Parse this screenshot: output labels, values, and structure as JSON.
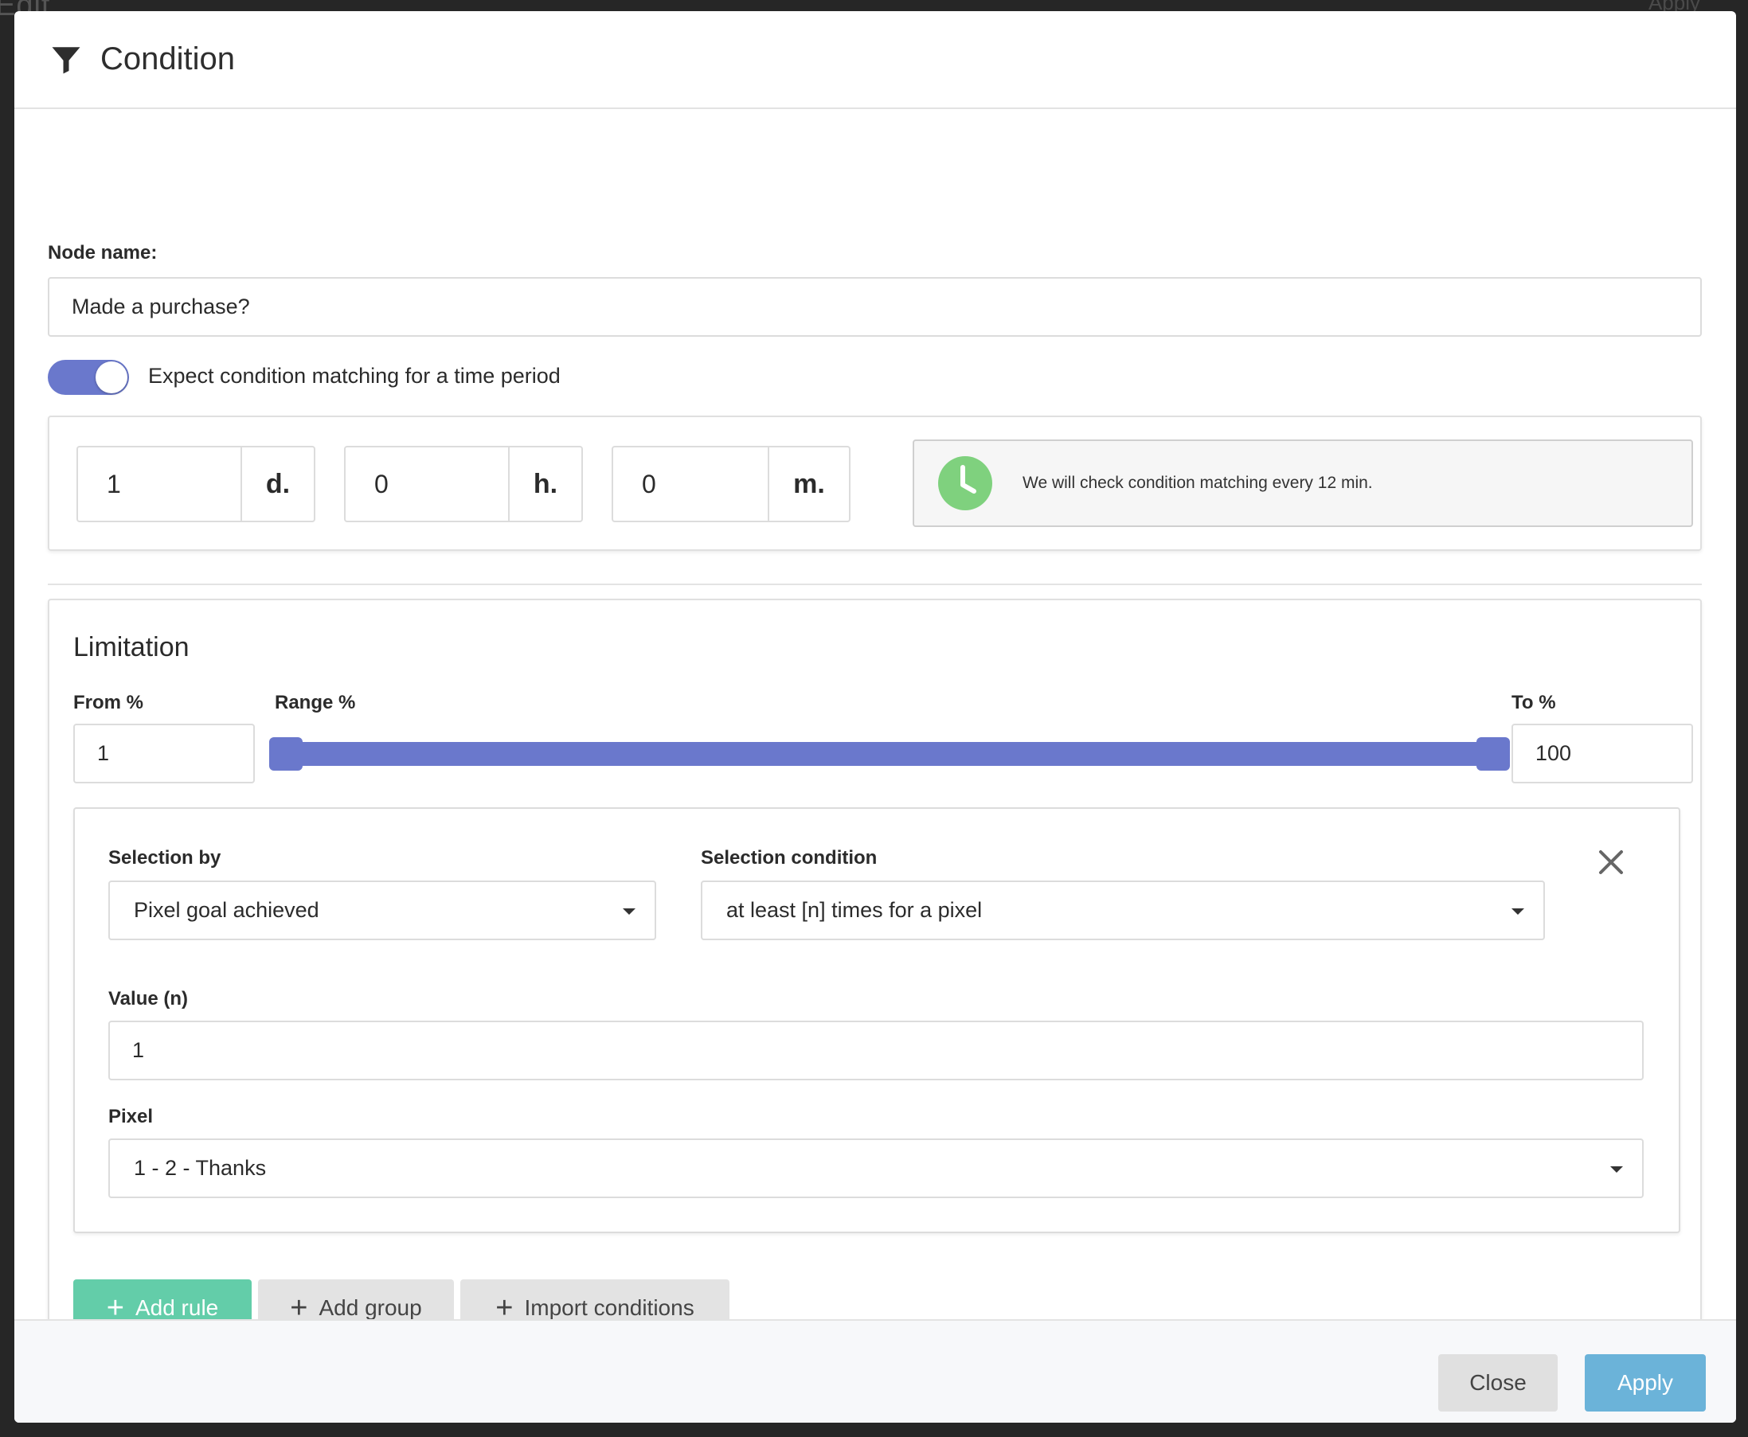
{
  "backdrop": {
    "title": "Edit",
    "apply_label": "Apply"
  },
  "modal": {
    "title": "Condition",
    "title_icon": "filter-icon"
  },
  "node": {
    "label": "Node name:",
    "value": "Made a purchase?"
  },
  "time_period": {
    "toggle_on": true,
    "toggle_label": "Expect condition matching for a time period",
    "days_value": "1",
    "days_unit": "d.",
    "hours_value": "0",
    "hours_unit": "h.",
    "minutes_value": "0",
    "minutes_unit": "m.",
    "info_icon": "clock-icon",
    "info_text": "We will check condition matching every 12 min."
  },
  "limitation": {
    "title": "Limitation",
    "from_label": "From %",
    "from_value": "1",
    "range_label": "Range %",
    "range": [
      1,
      100
    ],
    "to_label": "To %",
    "to_value": "100"
  },
  "rule": {
    "selection_by_label": "Selection by",
    "selection_by_value": "Pixel goal achieved",
    "selection_condition_label": "Selection condition",
    "selection_condition_value": "at least [n] times for a pixel",
    "value_label": "Value (n)",
    "value": "1",
    "pixel_label": "Pixel",
    "pixel_value": "1 - 2 - Thanks"
  },
  "buttons": {
    "add_rule": "Add rule",
    "add_group": "Add group",
    "import_conditions": "Import conditions"
  },
  "footer": {
    "close": "Close",
    "apply": "Apply"
  },
  "colors": {
    "accent": "#6a78cc",
    "add_rule_bg": "#63cda9",
    "apply_bg": "#6bb3d9",
    "clock": "#7fd17e"
  }
}
